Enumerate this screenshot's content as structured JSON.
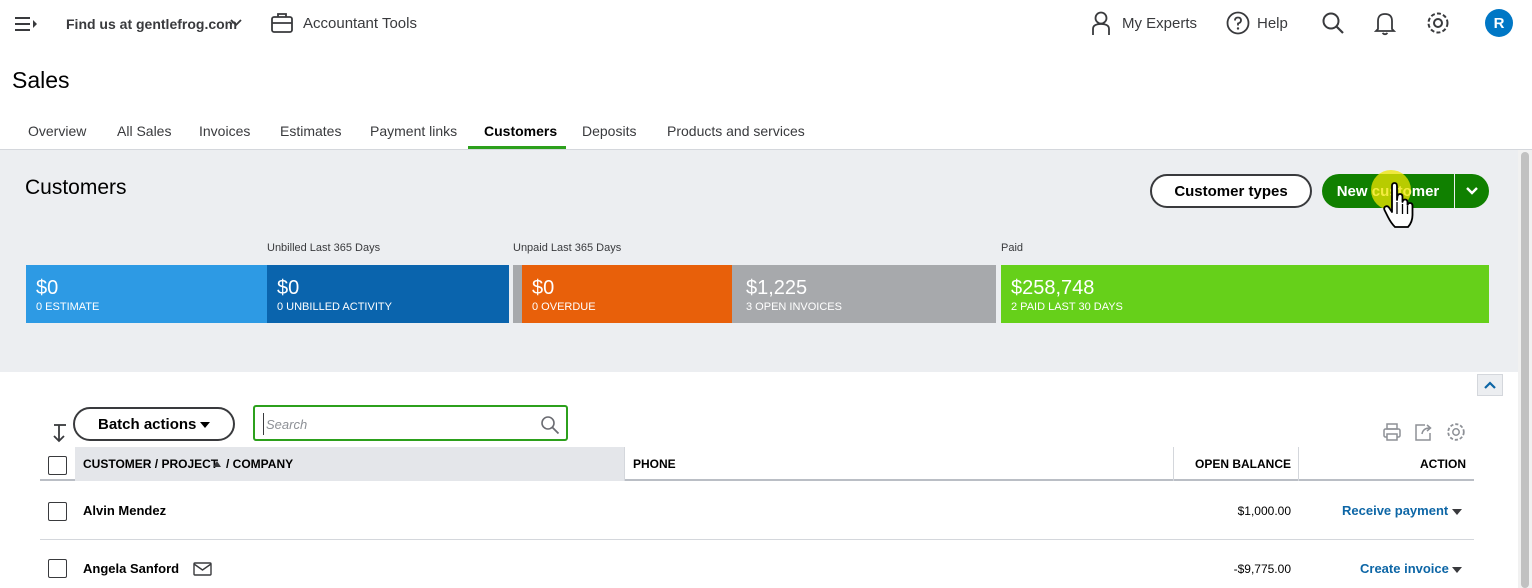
{
  "topbar": {
    "company": "Find us at gentlefrog.com",
    "accountant_tools": "Accountant Tools",
    "my_experts": "My Experts",
    "help": "Help",
    "avatar_initial": "R"
  },
  "page": {
    "title": "Sales",
    "tabs": [
      "Overview",
      "All Sales",
      "Invoices",
      "Estimates",
      "Payment links",
      "Customers",
      "Deposits",
      "Products and services"
    ],
    "active_tab": "Customers"
  },
  "customers_panel": {
    "title": "Customers",
    "customer_types_label": "Customer types",
    "new_customer_label": "New customer",
    "section_labels": {
      "unbilled": "Unbilled Last 365 Days",
      "unpaid": "Unpaid Last 365 Days",
      "paid": "Paid"
    },
    "stats": [
      {
        "amount": "$0",
        "label": "0 ESTIMATE",
        "color": "#2d9ae4"
      },
      {
        "amount": "$0",
        "label": "0 UNBILLED ACTIVITY",
        "color": "#0a64ad"
      },
      {
        "amount": "$0",
        "label": "0 OVERDUE",
        "color": "#e8600a"
      },
      {
        "amount": "$1,225",
        "label": "3 OPEN INVOICES",
        "color": "#a7a9ac"
      },
      {
        "amount": "$258,748",
        "label": "2 PAID LAST 30 DAYS",
        "color": "#66d01a"
      }
    ]
  },
  "toolbar": {
    "batch_actions_label": "Batch actions",
    "search_placeholder": "Search"
  },
  "table": {
    "headers": {
      "customer": "CUSTOMER / PROJECT",
      "company": "/ COMPANY",
      "phone": "PHONE",
      "open_balance": "OPEN BALANCE",
      "action": "ACTION"
    },
    "rows": [
      {
        "name": "Alvin Mendez",
        "open_balance": "$1,000.00",
        "action": "Receive payment",
        "has_email": false
      },
      {
        "name": "Angela Sanford",
        "open_balance": "-$9,775.00",
        "action": "Create invoice",
        "has_email": true
      }
    ]
  },
  "colors": {
    "brand_green": "#2ca01c",
    "button_green": "#108000",
    "link_blue": "#0d66a6",
    "avatar_blue": "#0077c5"
  }
}
